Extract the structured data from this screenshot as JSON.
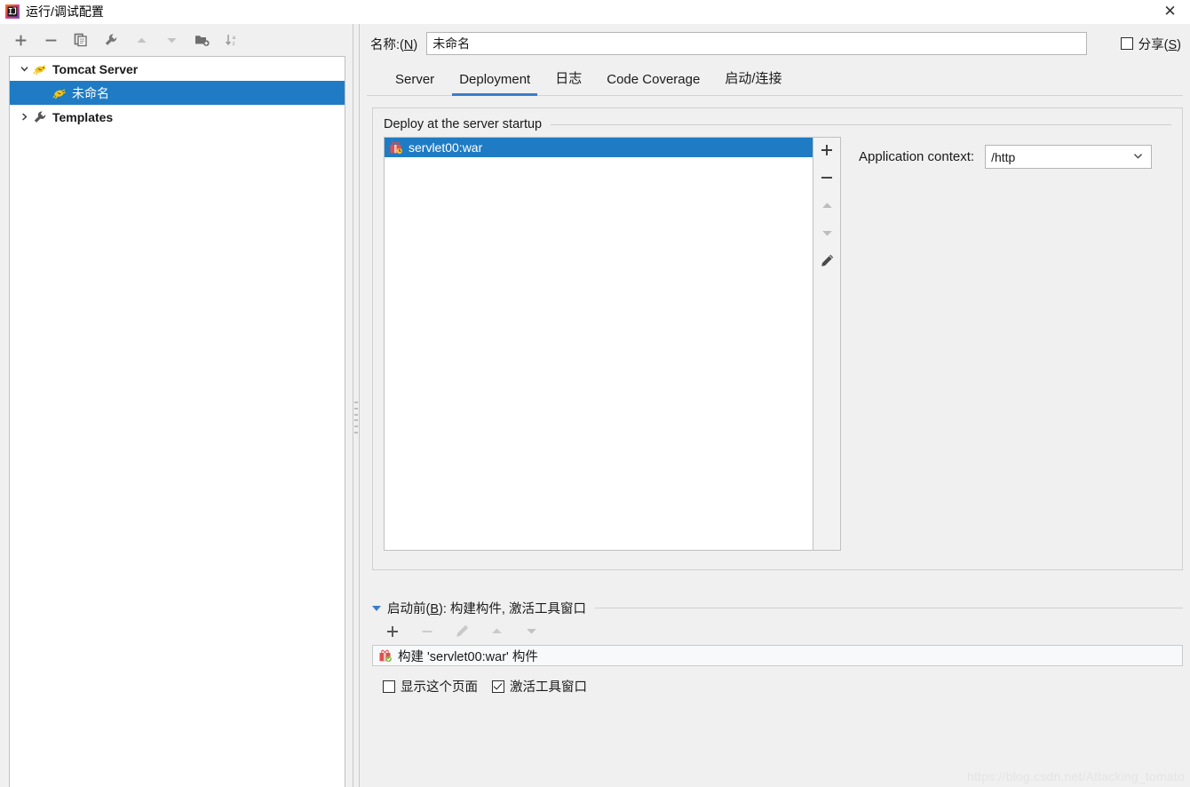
{
  "window": {
    "title": "运行/调试配置",
    "app_icon": "intellij-idea-icon",
    "close_label": "✕"
  },
  "left_panel": {
    "toolbar": [
      {
        "name": "add-configuration-button",
        "glyph": "+",
        "enabled": true
      },
      {
        "name": "remove-configuration-button",
        "glyph": "−",
        "enabled": true
      },
      {
        "name": "copy-configuration-button",
        "glyph": "copy-icon",
        "enabled": true
      },
      {
        "name": "edit-templates-button",
        "glyph": "wrench-icon",
        "enabled": true
      },
      {
        "name": "move-up-button",
        "glyph": "triangle-up-icon",
        "enabled": false
      },
      {
        "name": "move-down-button",
        "glyph": "triangle-down-icon",
        "enabled": false
      },
      {
        "name": "new-folder-button",
        "glyph": "folder-plus-icon",
        "enabled": true
      },
      {
        "name": "sort-alphabetically-button",
        "glyph": "sort-az-icon",
        "enabled": true
      }
    ],
    "tree": [
      {
        "label": "Tomcat Server",
        "level": 0,
        "expanded": true,
        "twisty": "chevron-down",
        "icon": "tomcat-icon",
        "selected": false
      },
      {
        "label": "未命名",
        "level": 1,
        "expanded": null,
        "twisty": "",
        "icon": "tomcat-icon",
        "selected": true
      },
      {
        "label": "Templates",
        "level": 0,
        "expanded": false,
        "twisty": "chevron-right",
        "icon": "wrench-icon",
        "selected": false
      }
    ]
  },
  "form": {
    "name_label": "名称:(",
    "name_mnemonic": "N",
    "name_label_end": ")",
    "name_value": "未命名",
    "share_label_start": "分享(",
    "share_mnemonic": "S",
    "share_label_end": ")",
    "share_checked": false
  },
  "tabs": [
    {
      "label": "Server",
      "active": false
    },
    {
      "label": "Deployment",
      "active": true
    },
    {
      "label": "日志",
      "active": false
    },
    {
      "label": "Code Coverage",
      "active": false
    },
    {
      "label": "启动/连接",
      "active": false
    }
  ],
  "deployment": {
    "group_title": "Deploy at the server startup",
    "artifacts": [
      {
        "label": "servlet00:war",
        "icon": "artifact-icon",
        "selected": true
      }
    ],
    "list_toolbar": [
      {
        "name": "add-artifact-button",
        "glyph": "+",
        "enabled": true
      },
      {
        "name": "remove-artifact-button",
        "glyph": "−",
        "enabled": true
      },
      {
        "name": "move-artifact-up-button",
        "glyph": "triangle-up-icon",
        "enabled": false
      },
      {
        "name": "move-artifact-down-button",
        "glyph": "triangle-down-icon",
        "enabled": false
      },
      {
        "name": "edit-artifact-button",
        "glyph": "pencil-icon",
        "enabled": true
      }
    ],
    "context_label": "Application context:",
    "context_value": "/http"
  },
  "before_launch": {
    "title_start": "启动前(",
    "title_mnemonic": "B",
    "title_end": "): 构建构件, 激活工具窗口",
    "toolbar": [
      {
        "name": "add-task-button",
        "glyph": "+",
        "enabled": true
      },
      {
        "name": "remove-task-button",
        "glyph": "−",
        "enabled": false
      },
      {
        "name": "edit-task-button",
        "glyph": "pencil-icon",
        "enabled": false
      },
      {
        "name": "move-task-up-button",
        "glyph": "triangle-up-icon",
        "enabled": false
      },
      {
        "name": "move-task-down-button",
        "glyph": "triangle-down-icon",
        "enabled": false
      }
    ],
    "tasks": [
      {
        "label": "构建 'servlet00:war' 构件",
        "icon": "artifact-icon"
      }
    ],
    "show_page_label": "显示这个页面",
    "show_page_checked": false,
    "activate_toolwindow_label": "激活工具窗口",
    "activate_toolwindow_checked": true
  },
  "watermark": "https://blog.csdn.net/Attacking_tomato",
  "colors": {
    "selection_blue": "#1f7cc4",
    "tab_accent": "#3a7dcc",
    "panel_bg": "#f0f0f0",
    "field_bg": "#ffffff",
    "border": "#c0c0c0"
  }
}
